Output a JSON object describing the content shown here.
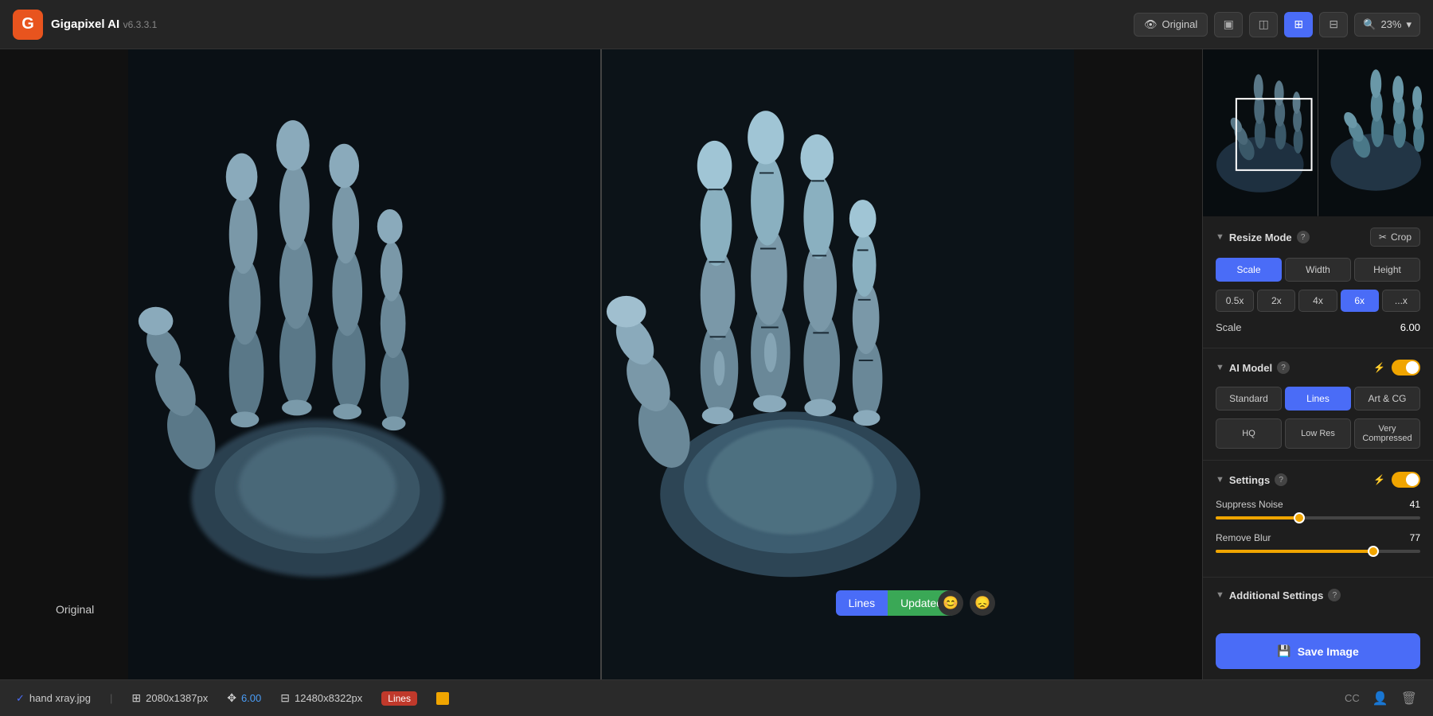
{
  "app": {
    "name": "Gigapixel AI",
    "version": "v6.3.3.1"
  },
  "topbar": {
    "original_btn": "Original",
    "zoom_label": "23%"
  },
  "statusbar": {
    "filename": "hand xray.jpg",
    "original_size": "2080x1387px",
    "scale_value": "6.00",
    "output_size": "12480x8322px",
    "model_label": "Lines",
    "check": "✓"
  },
  "image": {
    "original_label": "Original",
    "divider_visible": true
  },
  "badge": {
    "left": "Lines",
    "right": "Updated"
  },
  "panel": {
    "resize_section": {
      "title": "Resize Mode",
      "crop_label": "Crop",
      "modes": [
        "Scale",
        "Width",
        "Height"
      ],
      "active_mode": "Scale",
      "scales": [
        "0.5x",
        "2x",
        "4x",
        "6x",
        "...x"
      ],
      "active_scale": "6x",
      "scale_label": "Scale",
      "scale_value": "6.00"
    },
    "ai_model_section": {
      "title": "AI Model",
      "models": [
        "Standard",
        "Lines",
        "Art & CG"
      ],
      "active_model": "Lines",
      "qualities": [
        "HQ",
        "Low Res",
        "Very Compressed"
      ],
      "active_quality": null
    },
    "settings_section": {
      "title": "Settings",
      "suppress_noise_label": "Suppress Noise",
      "suppress_noise_value": "41",
      "suppress_noise_pct": 41,
      "remove_blur_label": "Remove Blur",
      "remove_blur_value": "77",
      "remove_blur_pct": 77
    },
    "additional_section": {
      "title": "Additional Settings"
    },
    "save_btn": "Save Image"
  }
}
